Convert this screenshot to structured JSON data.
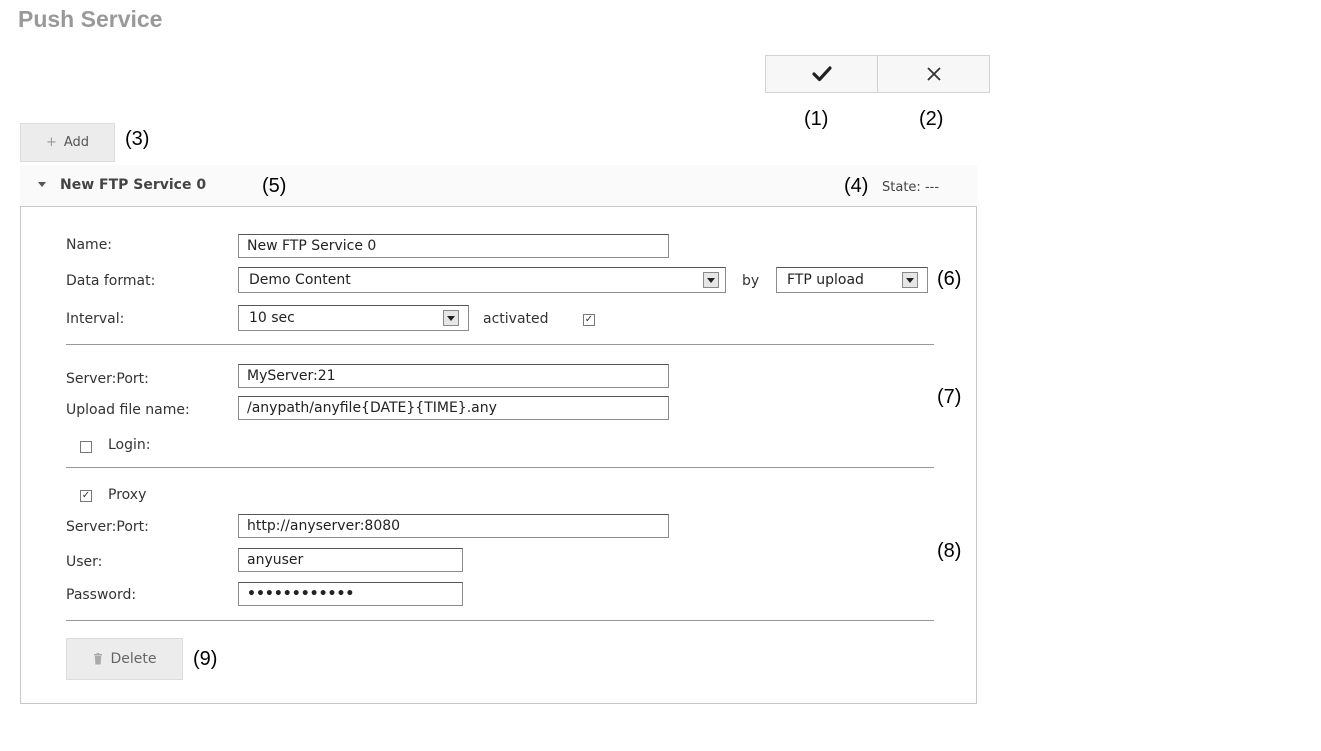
{
  "page": {
    "title": "Push Service"
  },
  "toolbar": {
    "confirm_icon": "checkmark-icon",
    "cancel_icon": "close-icon",
    "confirm_callout": "(1)",
    "cancel_callout": "(2)"
  },
  "add": {
    "label": "Add",
    "icon": "plus-icon",
    "callout": "(3)"
  },
  "service": {
    "title": "New FTP Service 0",
    "title_callout": "(5)",
    "state_callout": "(4)",
    "state_label": "State:",
    "state_value": "---",
    "general": {
      "name_label": "Name:",
      "name_value": "New FTP Service 0",
      "format_label": "Data format:",
      "format_value": "Demo Content",
      "by_label": "by",
      "method_value": "FTP upload",
      "method_callout": "(6)",
      "interval_label": "Interval:",
      "interval_value": "10 sec",
      "activated_label": "activated",
      "activated_checked": true
    },
    "ftp": {
      "server_label": "Server:Port:",
      "server_value": "MyServer:21",
      "filename_label": "Upload file name:",
      "filename_value": "/anypath/anyfile{DATE}{TIME}.any",
      "login_label": "Login:",
      "login_checked": false,
      "callout": "(7)"
    },
    "proxy": {
      "proxy_label": "Proxy",
      "proxy_checked": true,
      "server_label": "Server:Port:",
      "server_value": "http://anyserver:8080",
      "user_label": "User:",
      "user_value": "anyuser",
      "password_label": "Password:",
      "password_value": "••••••••••••",
      "callout": "(8)"
    },
    "delete": {
      "label": "Delete",
      "icon": "trash-icon",
      "callout": "(9)"
    }
  }
}
